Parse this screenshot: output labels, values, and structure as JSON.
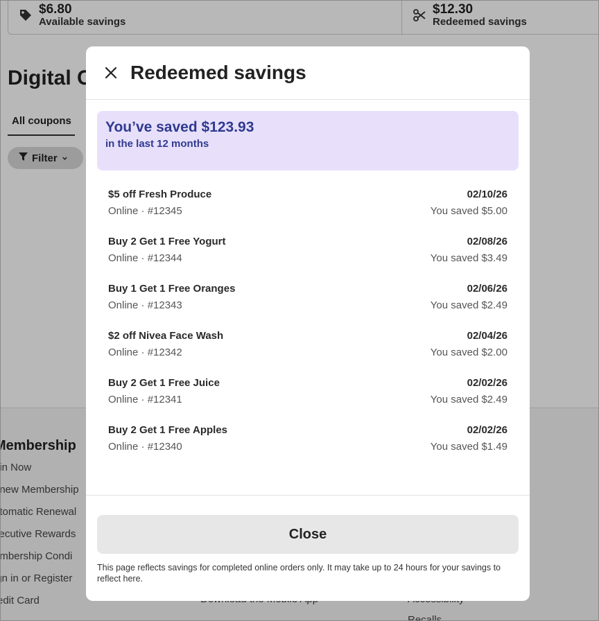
{
  "background": {
    "available": {
      "amount": "$6.80",
      "label": "Available savings",
      "icon": "tag-icon"
    },
    "redeemed": {
      "amount": "$12.30",
      "label": "Redeemed savings",
      "icon": "scissors-icon"
    },
    "page_title": "Digital C",
    "tab_all": "All coupons",
    "filter_label": "Filter",
    "footer_heading": "Membership",
    "footer_links": [
      "oin Now",
      "enew Membership",
      "utomatic Renewal",
      "xecutive Rewards",
      "embership Condi",
      "ign in or Register",
      "redit Card"
    ],
    "footer_link_mid": "Download the Mobile App",
    "footer_link_right": "Accessibility",
    "footer_link_right2": "Recalls"
  },
  "modal": {
    "title": "Redeemed savings",
    "summary": {
      "headline": "You’ve saved $123.93",
      "subline": "in the last 12 months"
    },
    "items": [
      {
        "title": "$5 off Fresh Produce",
        "meta": "Online · #12345",
        "date": "02/10/26",
        "saved": "You saved $5.00"
      },
      {
        "title": "Buy 2 Get 1 Free Yogurt",
        "meta": "Online · #12344",
        "date": "02/08/26",
        "saved": "You saved $3.49"
      },
      {
        "title": "Buy 1 Get 1 Free Oranges",
        "meta": "Online · #12343",
        "date": "02/06/26",
        "saved": "You saved $2.49"
      },
      {
        "title": "$2 off Nivea Face Wash",
        "meta": "Online · #12342",
        "date": "02/04/26",
        "saved": "You saved $2.00"
      },
      {
        "title": "Buy 2 Get 1 Free Juice",
        "meta": "Online · #12341",
        "date": "02/02/26",
        "saved": "You saved $2.49"
      },
      {
        "title": "Buy 2 Get 1 Free Apples",
        "meta": "Online · #12340",
        "date": "02/02/26",
        "saved": "You saved $1.49"
      }
    ],
    "close_label": "Close",
    "disclaimer": "This page reflects savings for completed online orders only. It may take up to 24 hours for your savings to reflect here."
  },
  "colors": {
    "summary_bg": "#e8e0fb",
    "summary_text": "#2f3a8f",
    "overlay": "rgba(0,0,0,0.28)"
  }
}
